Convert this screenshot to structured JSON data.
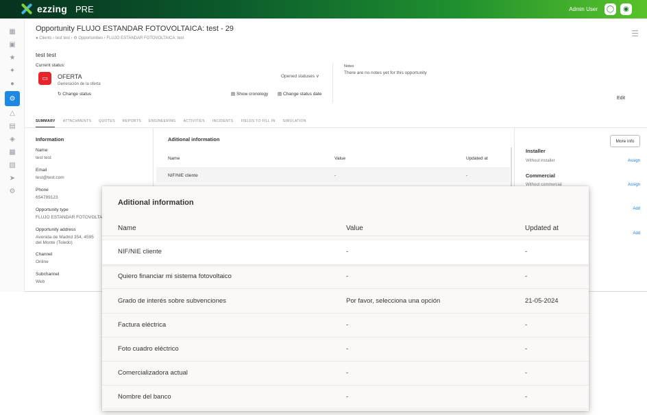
{
  "app": {
    "brand": "ezzing",
    "env": "PRE",
    "user": "Admin User"
  },
  "page": {
    "title": "Opportunity FLUJO ESTANDAR FOTOVOLTAICA: test - 29",
    "breadcrumb": [
      "Clients",
      "test test",
      "Opportunities",
      "FLUJO ESTANDAR FOTOVOLTAICA: test"
    ],
    "client_name": "test test"
  },
  "status": {
    "label": "Current status:",
    "name": "OFERTA",
    "description": "Generación de la oferta",
    "change_status": "Change status",
    "opened_statuses": "Opened statuses",
    "show_cronology": "Show cronology",
    "change_status_date": "Change status date"
  },
  "notes": {
    "label": "Notes",
    "text": "There are no notes yet for this opportunity",
    "edit": "Edit"
  },
  "tabs": [
    "SUMMARY",
    "ATTACHMENTS",
    "QUOTES",
    "REPORTS",
    "ENGINEERING",
    "ACTIVITIES",
    "INCIDENTS",
    "FIELDS TO FILL IN",
    "SIMULATION"
  ],
  "information": {
    "heading": "Information",
    "fields": [
      {
        "label": "Name",
        "value": "test test"
      },
      {
        "label": "Email",
        "value": "test@test.com"
      },
      {
        "label": "Phone",
        "value": "654789123"
      },
      {
        "label": "Opportunity type",
        "value": "FLUJO ESTANDAR FOTOVOLTA"
      },
      {
        "label": "Opportunity address",
        "value": "Avenida de Madrid 354, 4595"
      },
      {
        "label": "Channel",
        "value": "Online"
      },
      {
        "label": "Subchannel",
        "value": "Web"
      }
    ],
    "address_line2": "del Monte (Toledo)"
  },
  "aditional": {
    "heading": "Aditional information",
    "columns": [
      "Name",
      "Value",
      "Updated at"
    ],
    "rows": [
      {
        "name": "NIF/NIE cliente",
        "value": "-",
        "updated": "-"
      },
      {
        "name": "Quiero financiar mi sistema fotovoltaico",
        "value": "-",
        "updated": "-"
      },
      {
        "name": "Grado de interés sobre subvenciones",
        "value": "Por favor, selecciona una opción",
        "updated": "21-05-2024"
      },
      {
        "name": "Factura eléctrica",
        "value": "-",
        "updated": "-"
      },
      {
        "name": "Foto cuadro eléctrico",
        "value": "-",
        "updated": "-"
      },
      {
        "name": "Comercializadora actual",
        "value": "-",
        "updated": "-"
      },
      {
        "name": "Nombre del banco",
        "value": "-",
        "updated": "-"
      }
    ]
  },
  "right": {
    "more_info": "More info",
    "installer": {
      "heading": "Installer",
      "text": "Without installer",
      "link": "Assign"
    },
    "commercial": {
      "heading": "Commercial",
      "text": "Without commercial",
      "link": "Assign"
    },
    "add1": "Add",
    "add2": "Add"
  },
  "colors": {
    "accent": "#1e88e5",
    "status": "#e5252a",
    "brand_dark": "#07321f",
    "brand_light": "#59c22a"
  }
}
